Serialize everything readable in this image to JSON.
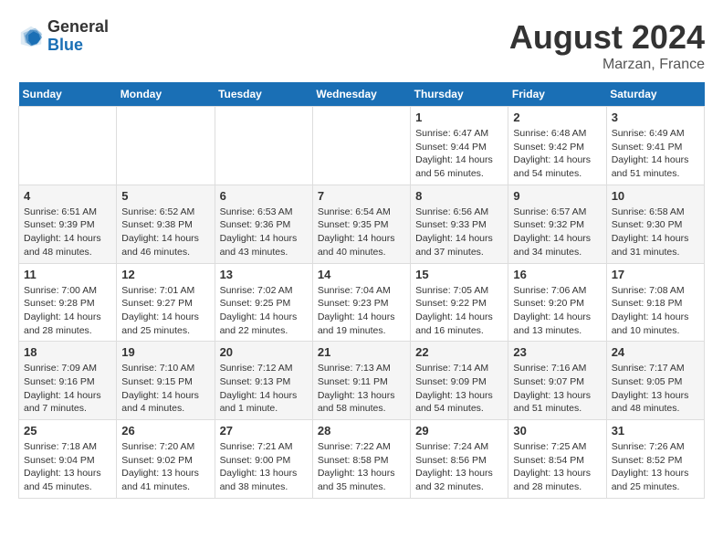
{
  "header": {
    "logo_general": "General",
    "logo_blue": "Blue",
    "main_title": "August 2024",
    "subtitle": "Marzan, France"
  },
  "weekdays": [
    "Sunday",
    "Monday",
    "Tuesday",
    "Wednesday",
    "Thursday",
    "Friday",
    "Saturday"
  ],
  "weeks": [
    [
      {
        "day": "",
        "info": ""
      },
      {
        "day": "",
        "info": ""
      },
      {
        "day": "",
        "info": ""
      },
      {
        "day": "",
        "info": ""
      },
      {
        "day": "1",
        "info": "Sunrise: 6:47 AM\nSunset: 9:44 PM\nDaylight: 14 hours\nand 56 minutes."
      },
      {
        "day": "2",
        "info": "Sunrise: 6:48 AM\nSunset: 9:42 PM\nDaylight: 14 hours\nand 54 minutes."
      },
      {
        "day": "3",
        "info": "Sunrise: 6:49 AM\nSunset: 9:41 PM\nDaylight: 14 hours\nand 51 minutes."
      }
    ],
    [
      {
        "day": "4",
        "info": "Sunrise: 6:51 AM\nSunset: 9:39 PM\nDaylight: 14 hours\nand 48 minutes."
      },
      {
        "day": "5",
        "info": "Sunrise: 6:52 AM\nSunset: 9:38 PM\nDaylight: 14 hours\nand 46 minutes."
      },
      {
        "day": "6",
        "info": "Sunrise: 6:53 AM\nSunset: 9:36 PM\nDaylight: 14 hours\nand 43 minutes."
      },
      {
        "day": "7",
        "info": "Sunrise: 6:54 AM\nSunset: 9:35 PM\nDaylight: 14 hours\nand 40 minutes."
      },
      {
        "day": "8",
        "info": "Sunrise: 6:56 AM\nSunset: 9:33 PM\nDaylight: 14 hours\nand 37 minutes."
      },
      {
        "day": "9",
        "info": "Sunrise: 6:57 AM\nSunset: 9:32 PM\nDaylight: 14 hours\nand 34 minutes."
      },
      {
        "day": "10",
        "info": "Sunrise: 6:58 AM\nSunset: 9:30 PM\nDaylight: 14 hours\nand 31 minutes."
      }
    ],
    [
      {
        "day": "11",
        "info": "Sunrise: 7:00 AM\nSunset: 9:28 PM\nDaylight: 14 hours\nand 28 minutes."
      },
      {
        "day": "12",
        "info": "Sunrise: 7:01 AM\nSunset: 9:27 PM\nDaylight: 14 hours\nand 25 minutes."
      },
      {
        "day": "13",
        "info": "Sunrise: 7:02 AM\nSunset: 9:25 PM\nDaylight: 14 hours\nand 22 minutes."
      },
      {
        "day": "14",
        "info": "Sunrise: 7:04 AM\nSunset: 9:23 PM\nDaylight: 14 hours\nand 19 minutes."
      },
      {
        "day": "15",
        "info": "Sunrise: 7:05 AM\nSunset: 9:22 PM\nDaylight: 14 hours\nand 16 minutes."
      },
      {
        "day": "16",
        "info": "Sunrise: 7:06 AM\nSunset: 9:20 PM\nDaylight: 14 hours\nand 13 minutes."
      },
      {
        "day": "17",
        "info": "Sunrise: 7:08 AM\nSunset: 9:18 PM\nDaylight: 14 hours\nand 10 minutes."
      }
    ],
    [
      {
        "day": "18",
        "info": "Sunrise: 7:09 AM\nSunset: 9:16 PM\nDaylight: 14 hours\nand 7 minutes."
      },
      {
        "day": "19",
        "info": "Sunrise: 7:10 AM\nSunset: 9:15 PM\nDaylight: 14 hours\nand 4 minutes."
      },
      {
        "day": "20",
        "info": "Sunrise: 7:12 AM\nSunset: 9:13 PM\nDaylight: 14 hours\nand 1 minute."
      },
      {
        "day": "21",
        "info": "Sunrise: 7:13 AM\nSunset: 9:11 PM\nDaylight: 13 hours\nand 58 minutes."
      },
      {
        "day": "22",
        "info": "Sunrise: 7:14 AM\nSunset: 9:09 PM\nDaylight: 13 hours\nand 54 minutes."
      },
      {
        "day": "23",
        "info": "Sunrise: 7:16 AM\nSunset: 9:07 PM\nDaylight: 13 hours\nand 51 minutes."
      },
      {
        "day": "24",
        "info": "Sunrise: 7:17 AM\nSunset: 9:05 PM\nDaylight: 13 hours\nand 48 minutes."
      }
    ],
    [
      {
        "day": "25",
        "info": "Sunrise: 7:18 AM\nSunset: 9:04 PM\nDaylight: 13 hours\nand 45 minutes."
      },
      {
        "day": "26",
        "info": "Sunrise: 7:20 AM\nSunset: 9:02 PM\nDaylight: 13 hours\nand 41 minutes."
      },
      {
        "day": "27",
        "info": "Sunrise: 7:21 AM\nSunset: 9:00 PM\nDaylight: 13 hours\nand 38 minutes."
      },
      {
        "day": "28",
        "info": "Sunrise: 7:22 AM\nSunset: 8:58 PM\nDaylight: 13 hours\nand 35 minutes."
      },
      {
        "day": "29",
        "info": "Sunrise: 7:24 AM\nSunset: 8:56 PM\nDaylight: 13 hours\nand 32 minutes."
      },
      {
        "day": "30",
        "info": "Sunrise: 7:25 AM\nSunset: 8:54 PM\nDaylight: 13 hours\nand 28 minutes."
      },
      {
        "day": "31",
        "info": "Sunrise: 7:26 AM\nSunset: 8:52 PM\nDaylight: 13 hours\nand 25 minutes."
      }
    ]
  ]
}
